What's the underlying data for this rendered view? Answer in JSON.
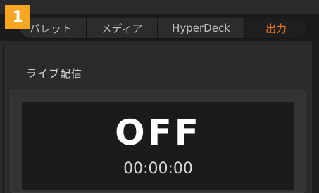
{
  "badge": {
    "number": "1",
    "color": "#f5a623"
  },
  "tabs": [
    {
      "label": "パレット",
      "active": false
    },
    {
      "label": "メディア",
      "active": false
    },
    {
      "label": "HyperDeck",
      "active": false
    },
    {
      "label": "出力",
      "active": true
    }
  ],
  "accent_color": "#f0761e",
  "section": {
    "title": "ライブ配信"
  },
  "stream": {
    "status": "OFF",
    "timecode": "00:00:00"
  }
}
